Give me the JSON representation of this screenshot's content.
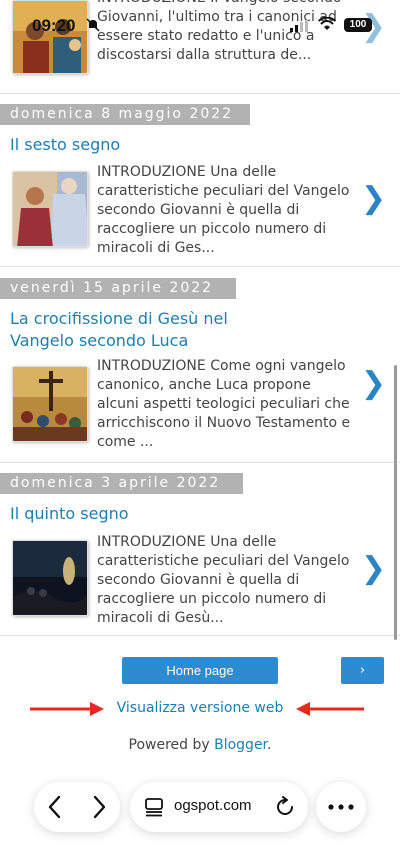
{
  "status": {
    "time": "09:20",
    "battery": "100"
  },
  "posts": [
    {
      "snippet": "INTRODUZIONE Il Vangelo secondo Giovanni, l'ultimo tra i canonici ad essere stato redatto e l'unico a discostarsi dalla struttura de..."
    },
    {
      "date": "domenica 8 maggio 2022",
      "title": "Il sesto segno",
      "snippet": "INTRODUZIONE   Una delle caratteristiche peculiari del Vangelo secondo Giovanni è quella di raccogliere un piccolo numero di miracoli di Ges..."
    },
    {
      "date": "venerdì 15 aprile 2022",
      "title": "La crocifissione di Gesù nel Vangelo secondo Luca",
      "snippet": "INTRODUZIONE Come ogni vangelo canonico, anche Luca propone alcuni aspetti teologici peculiari che arricchiscono il Nuovo Testamento e come ..."
    },
    {
      "date": "domenica 3 aprile 2022",
      "title": "Il quinto segno",
      "snippet": "INTRODUZIONE  Una delle caratteristiche peculiari del Vangelo secondo Giovanni è quella di raccogliere un piccolo numero di miracoli di Gesù..."
    }
  ],
  "chevron": "❯",
  "footer": {
    "home_label": "Home page",
    "next_label": "›",
    "web_version": "Visualizza versione web",
    "powered_prefix": "Powered by ",
    "powered_link": "Blogger",
    "powered_suffix": "."
  },
  "browser": {
    "url": "ogspot.com"
  },
  "colors": {
    "accent": "#2c8bd1",
    "link": "#1b7fb0",
    "date_bar": "#b2b2b2",
    "annotation_arrow": "#e8281e"
  }
}
